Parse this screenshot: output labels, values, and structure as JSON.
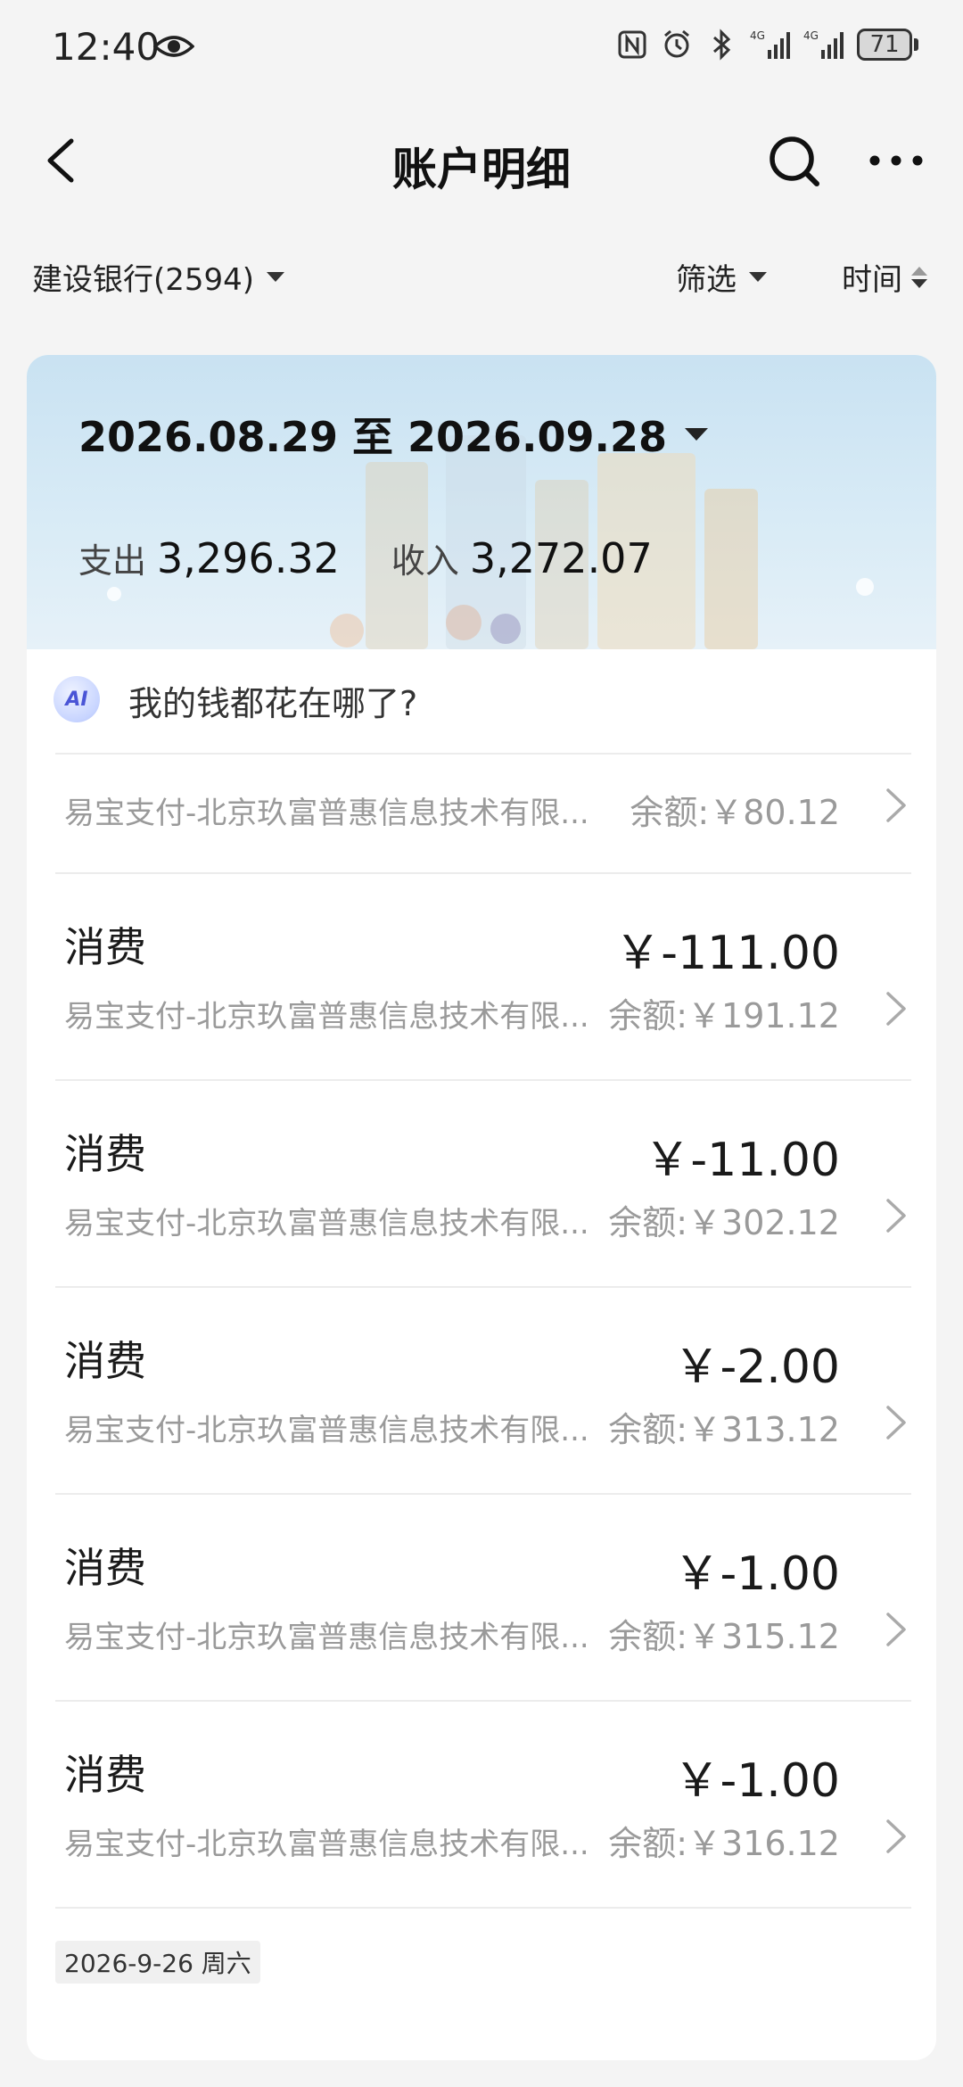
{
  "status_bar": {
    "time": "12:40",
    "battery": "71",
    "icons": [
      "eye-icon",
      "nfc-icon",
      "alarm-icon",
      "bluetooth-icon",
      "signal-4g-icon",
      "signal-4g-icon",
      "battery-icon"
    ]
  },
  "nav": {
    "title": "账户明细",
    "back_icon": "chevron-left-icon",
    "search_icon": "search-icon",
    "more_icon": "more-dots-icon"
  },
  "filters": {
    "account": "建设银行(2594)",
    "filter_label": "筛选",
    "time_label": "时间"
  },
  "summary": {
    "date_range": "2026.08.29 至 2026.09.28",
    "expense_label": "支出",
    "expense_value": "3,296.32",
    "income_label": "收入",
    "income_value": "3,272.07"
  },
  "ai": {
    "badge": "AI",
    "prompt": "我的钱都花在哪了?"
  },
  "first_row": {
    "description": "易宝支付-北京玖富普惠信息技术有限...",
    "balance": "余额:￥80.12"
  },
  "transactions": [
    {
      "title": "消费",
      "amount": "￥-111.00",
      "description": "易宝支付-北京玖富普惠信息技术有限...",
      "balance": "余额:￥191.12"
    },
    {
      "title": "消费",
      "amount": "￥-11.00",
      "description": "易宝支付-北京玖富普惠信息技术有限...",
      "balance": "余额:￥302.12"
    },
    {
      "title": "消费",
      "amount": "￥-2.00",
      "description": "易宝支付-北京玖富普惠信息技术有限...",
      "balance": "余额:￥313.12"
    },
    {
      "title": "消费",
      "amount": "￥-1.00",
      "description": "易宝支付-北京玖富普惠信息技术有限...",
      "balance": "余额:￥315.12"
    },
    {
      "title": "消费",
      "amount": "￥-1.00",
      "description": "易宝支付-北京玖富普惠信息技术有限...",
      "balance": "余额:￥316.12"
    }
  ],
  "date_header": "2026-9-26 周六"
}
